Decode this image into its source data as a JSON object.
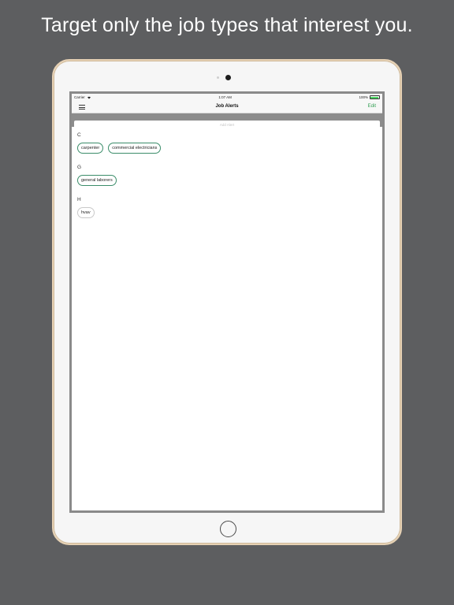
{
  "promo": {
    "headline": "Target only the job types that interest you."
  },
  "status_bar": {
    "carrier": "Carrier",
    "time": "1:07 AM",
    "battery": "100%"
  },
  "navbar": {
    "title": "Job Alerts",
    "edit_label": "Edit"
  },
  "search": {
    "placeholder": "Add Alert"
  },
  "sections": [
    {
      "letter": "C",
      "chips": [
        "carpenter",
        "commercial electricians"
      ]
    },
    {
      "letter": "G",
      "chips": [
        "general laborers"
      ]
    },
    {
      "letter": "H",
      "chips": [
        "hvav"
      ]
    }
  ],
  "colors": {
    "accent": "#2e9d4f",
    "background": "#5d5e60"
  }
}
